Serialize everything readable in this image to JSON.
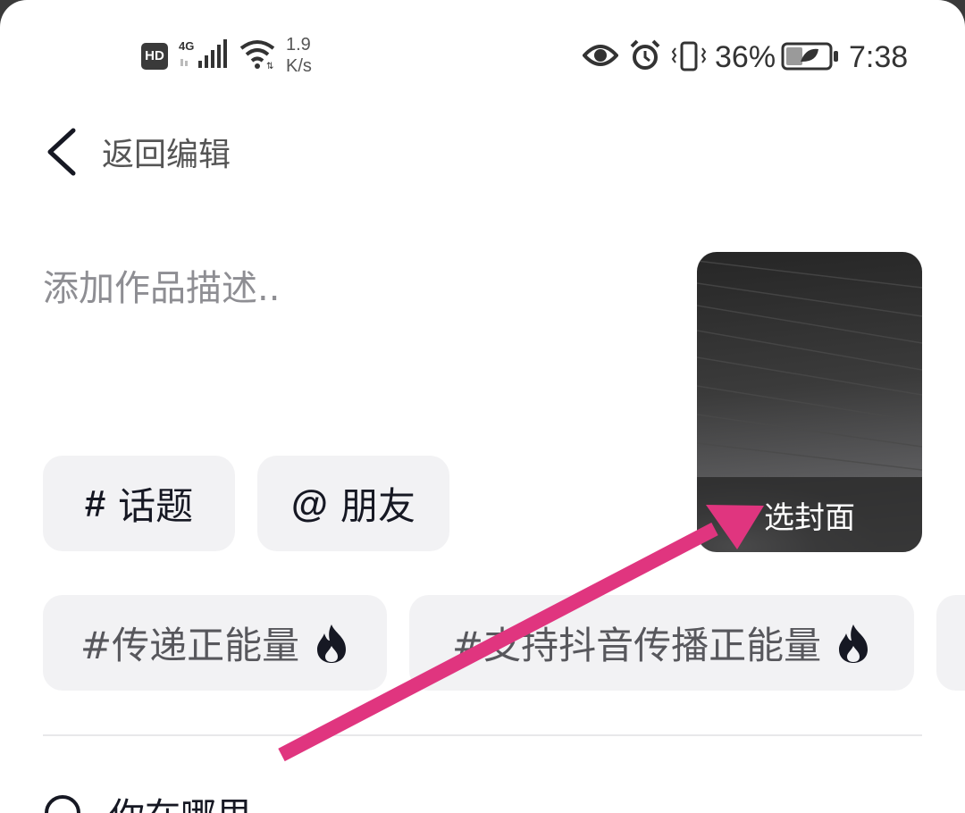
{
  "status_bar": {
    "hd": "HD",
    "network": "4G",
    "speed_value": "1.9",
    "speed_unit": "K/s",
    "battery_percent": "36%",
    "time": "7:38",
    "icons": [
      "signal-icon",
      "wifi-icon",
      "eye-icon",
      "alarm-icon",
      "vibrate-icon",
      "battery-icon"
    ]
  },
  "header": {
    "back_label": "返回编辑"
  },
  "description": {
    "placeholder": "添加作品描述.."
  },
  "cover": {
    "label": "选封面"
  },
  "chips": [
    {
      "symbol": "#",
      "label": "话题"
    },
    {
      "symbol": "@",
      "label": "朋友"
    }
  ],
  "hashtags": [
    {
      "label": "#传递正能量",
      "icon": "fire-icon"
    },
    {
      "label": "#支持抖音传播正能量",
      "icon": "fire-icon"
    }
  ],
  "bottom": {
    "label": "你在哪里"
  },
  "annotation": {
    "color": "#e0357f"
  }
}
